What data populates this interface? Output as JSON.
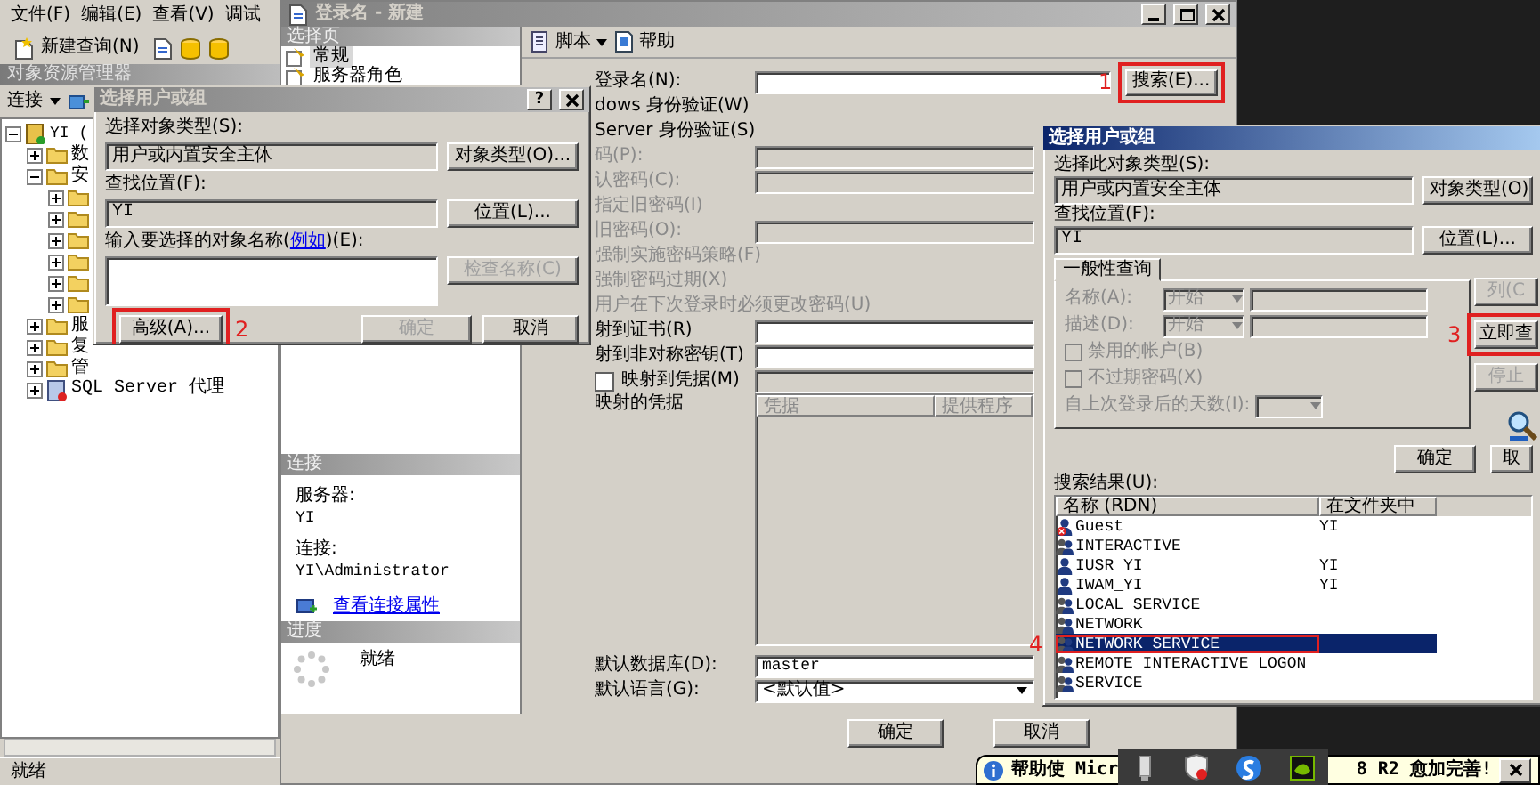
{
  "main_window": {
    "menu": [
      "文件(F)",
      "编辑(E)",
      "查看(V)",
      "调试"
    ],
    "toolbar": {
      "new_query": "新建查询(N)"
    },
    "object_explorer": {
      "title": "对象资源管理器",
      "connect": "连接",
      "tree": [
        {
          "label": "YI (",
          "kind": "server",
          "expanded": true,
          "children": [
            {
              "label": "数",
              "kind": "folder",
              "expanded": false
            },
            {
              "label": "安",
              "kind": "folder",
              "expanded": true,
              "children": [
                {
                  "kind": "folder",
                  "expanded": false
                },
                {
                  "kind": "folder",
                  "expanded": false
                },
                {
                  "kind": "folder",
                  "expanded": false
                },
                {
                  "kind": "folder",
                  "expanded": false
                },
                {
                  "kind": "folder",
                  "expanded": false
                },
                {
                  "kind": "folder",
                  "expanded": false
                }
              ]
            },
            {
              "label": "服",
              "kind": "folder",
              "expanded": false
            },
            {
              "label": "复",
              "kind": "folder",
              "expanded": false
            },
            {
              "label": "管",
              "kind": "folder",
              "expanded": false
            },
            {
              "label": "SQL Server 代理",
              "kind": "agent",
              "expanded": false
            }
          ]
        }
      ]
    },
    "status_bar": "就绪"
  },
  "login_window": {
    "title": "登录名 - 新建",
    "pages_header": "选择页",
    "pages": [
      {
        "label": "常规",
        "selected": true
      },
      {
        "label": "服务器角色",
        "selected": false
      }
    ],
    "toolbar": {
      "script": "脚本",
      "help": "帮助"
    },
    "form": [
      {
        "kind": "field",
        "label": "登录名(N):",
        "disabled": false,
        "button": "搜索(E)...",
        "annotation": "1"
      },
      {
        "kind": "text",
        "label": "dows 身份验证(W)",
        "disabled": false
      },
      {
        "kind": "text",
        "label": "Server 身份验证(S)",
        "disabled": false
      },
      {
        "kind": "field",
        "label": "码(P):",
        "disabled": true
      },
      {
        "kind": "field",
        "label": "认密码(C):",
        "disabled": true
      },
      {
        "kind": "text",
        "label": "指定旧密码(I)",
        "disabled": true
      },
      {
        "kind": "field",
        "label": "旧密码(O):",
        "disabled": true
      },
      {
        "kind": "text",
        "label": "强制实施密码策略(F)",
        "disabled": true
      },
      {
        "kind": "text",
        "label": "强制密码过期(X)",
        "disabled": true
      },
      {
        "kind": "text",
        "label": "用户在下次登录时必须更改密码(U)",
        "disabled": true
      },
      {
        "kind": "field",
        "label": "射到证书(R)",
        "disabled": false
      },
      {
        "kind": "field",
        "label": "射到非对称密钥(T)",
        "disabled": false
      },
      {
        "kind": "checkbox",
        "label": "映射到凭据(M)",
        "checked": false,
        "disabled": false
      },
      {
        "kind": "grid",
        "label": "映射的凭据",
        "columns": [
          "凭据",
          "提供程序"
        ],
        "disabled": false
      },
      {
        "kind": "field",
        "label": "默认数据库(D):",
        "value": "master",
        "disabled": false
      },
      {
        "kind": "combo",
        "label": "默认语言(G):",
        "value": "<默认值>",
        "disabled": false
      }
    ],
    "connection_header": "连接",
    "server_label": "服务器:",
    "server": "YI",
    "connection_label": "连接:",
    "connection": "YI\\Administrator",
    "properties_link": "查看连接属性",
    "progress_header": "进度",
    "progress_status": "就绪",
    "buttons": [
      "确定",
      "取消"
    ]
  },
  "select_dialog": {
    "title": "选择用户或组",
    "help_button": "?",
    "object_type_label": "选择对象类型(S):",
    "object_type": "用户或内置安全主体",
    "object_type_button": "对象类型(O)...",
    "location_label": "查找位置(F):",
    "location": "YI",
    "location_button": "位置(L)...",
    "names_label_start": "输入要选择的对象名称(",
    "example_link": "例如",
    "names_label_end": ")(E):",
    "buttons": [
      {
        "label": "检查名称(C)",
        "disabled": true
      },
      {
        "label": "高级(A)...",
        "disabled": false,
        "annotation": "2"
      },
      {
        "label": "确定",
        "disabled": true
      },
      {
        "label": "取消",
        "disabled": false
      }
    ]
  },
  "advanced_dialog": {
    "title": "选择用户或组",
    "object_type_label": "选择此对象类型(S):",
    "object_type": "用户或内置安全主体",
    "object_type_button": "对象类型(O)",
    "location_label": "查找位置(F):",
    "location": "YI",
    "location_button": "位置(L)...",
    "tab": "一般性查询",
    "query": {
      "name_label": "名称(A):",
      "name_mode": "开始",
      "desc_label": "描述(D):",
      "desc_mode": "开始",
      "checks": [
        {
          "label": "禁用的帐户(B)",
          "checked": false
        },
        {
          "label": "不过期密码(X)",
          "checked": false
        }
      ],
      "days_label": "自上次登录后的天数(I):"
    },
    "side_buttons": [
      {
        "label": "列(C",
        "disabled": true
      },
      {
        "label": "立即查",
        "disabled": false,
        "annotation": "3"
      },
      {
        "label": "停止",
        "disabled": true
      }
    ],
    "buttons": [
      "确定",
      "取"
    ],
    "results_label": "搜索结果(U):",
    "columns": [
      "名称 (RDN)",
      "在文件夹中"
    ],
    "results": [
      {
        "name": "Guest",
        "folder": "YI",
        "kind": "user",
        "disabled": true,
        "selected": false
      },
      {
        "name": "INTERACTIVE",
        "kind": "group",
        "disabled": false,
        "selected": false
      },
      {
        "name": "IUSR_YI",
        "folder": "YI",
        "kind": "user",
        "disabled": false,
        "selected": false
      },
      {
        "name": "IWAM_YI",
        "folder": "YI",
        "kind": "user",
        "disabled": false,
        "selected": false
      },
      {
        "name": "LOCAL SERVICE",
        "kind": "group",
        "disabled": false,
        "selected": false
      },
      {
        "name": "NETWORK",
        "kind": "group",
        "disabled": false,
        "selected": false
      },
      {
        "name": "NETWORK SERVICE",
        "kind": "group",
        "disabled": false,
        "selected": true,
        "annotation": "4"
      },
      {
        "name": "REMOTE INTERACTIVE LOGON",
        "kind": "group",
        "disabled": false,
        "selected": false
      },
      {
        "name": "SERVICE",
        "kind": "group",
        "disabled": false,
        "selected": false
      }
    ]
  },
  "notification": {
    "text_start": "帮助使 Micr",
    "text_end": "8 R2 愈加完善!"
  }
}
